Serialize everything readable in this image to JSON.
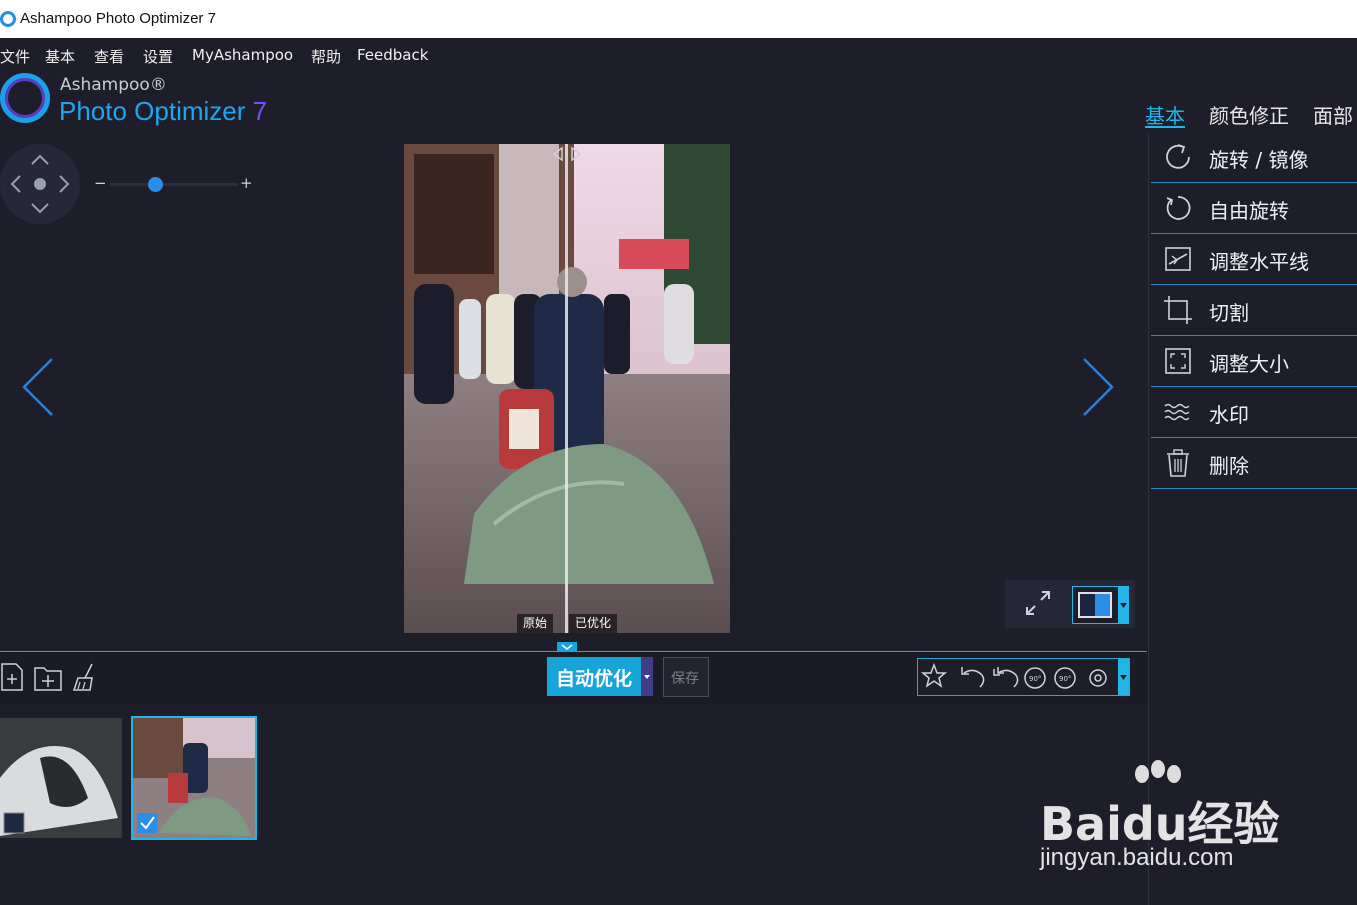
{
  "window": {
    "title": "Ashampoo Photo Optimizer 7"
  },
  "menu": [
    "文件",
    "基本",
    "查看",
    "设置",
    "MyAshampoo",
    "帮助",
    "Feedback"
  ],
  "logo": {
    "brand": "Ashampoo®",
    "product": "Photo Optimizer",
    "version": "7"
  },
  "tabs": [
    {
      "label": "基本",
      "active": true
    },
    {
      "label": "颜色修正",
      "active": false
    },
    {
      "label": "面部",
      "active": false
    }
  ],
  "tools": [
    {
      "label": "旋转 / 镜像",
      "icon": "rotate-mirror-icon"
    },
    {
      "label": "自由旋转",
      "icon": "free-rotate-icon"
    },
    {
      "label": "调整水平线",
      "icon": "horizon-icon"
    },
    {
      "label": "切割",
      "icon": "crop-icon"
    },
    {
      "label": "调整大小",
      "icon": "resize-icon"
    },
    {
      "label": "水印",
      "icon": "watermark-icon"
    },
    {
      "label": "删除",
      "icon": "trash-icon"
    }
  ],
  "zoom": {
    "minus": "−",
    "plus": "+",
    "level": 0.35
  },
  "compare": {
    "original": "原始",
    "optimized": "已优化"
  },
  "toolbar": {
    "auto_optimize": "自动优化",
    "save": "保存"
  },
  "watermark": {
    "brand": "Baidu经验",
    "url": "jingyan.baidu.com"
  },
  "colors": {
    "accent": "#22b6e8",
    "background": "#1d1e29",
    "purple": "#7a4cff"
  }
}
